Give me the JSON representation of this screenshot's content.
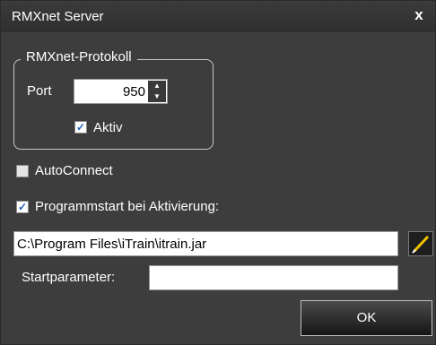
{
  "window": {
    "title": "RMXnet Server",
    "close_glyph": "x"
  },
  "protocol_group": {
    "legend": "RMXnet-Protokoll",
    "port_label": "Port",
    "port_value": "950",
    "aktiv_label": "Aktiv",
    "aktiv_checked": true
  },
  "autoconnect": {
    "label": "AutoConnect",
    "checked": false
  },
  "programmstart": {
    "label": "Programmstart bei Aktivierung:",
    "checked": true
  },
  "program_path": {
    "value": "C:\\Program Files\\iTrain\\itrain.jar"
  },
  "startparameter": {
    "label": "Startparameter:",
    "value": ""
  },
  "buttons": {
    "ok_label": "OK"
  },
  "colors": {
    "window_bg": "#3d3d3d",
    "browse_icon": "#f2c200",
    "check_accent": "#2060c0"
  }
}
